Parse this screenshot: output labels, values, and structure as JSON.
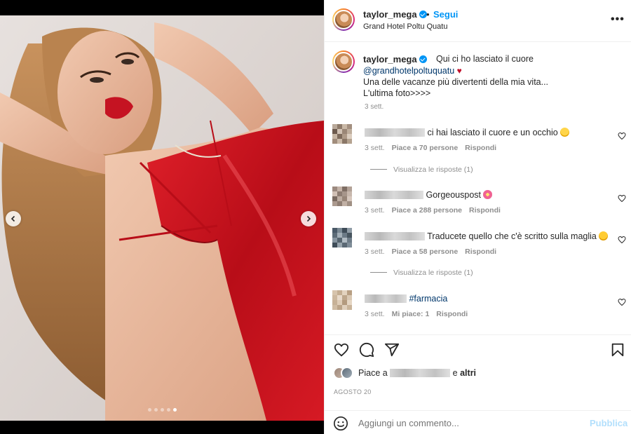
{
  "post": {
    "username": "taylor_mega",
    "bullet": "•",
    "follow_label": "Segui",
    "location": "Grand Hotel Poltu Quatu",
    "more_label": "•••"
  },
  "caption": {
    "username": "taylor_mega",
    "line1": "Qui ci ho lasciato il cuore",
    "mention": "@grandhotelpoltuquatu",
    "heart": "♥",
    "line2": "Una delle vacanze più divertenti della mia vita...",
    "line3": "L'ultima foto>>>>",
    "time": "3 sett."
  },
  "comments": [
    {
      "text": "ci hai lasciato il cuore e un occhio",
      "emoji": "grinning-emoji",
      "time": "3 sett.",
      "likes": "Piace a 70 persone",
      "reply": "Rispondi",
      "view_replies": "Visualizza le risposte (1)"
    },
    {
      "text": "Gorgeouspost",
      "emoji": "flower-emoji",
      "time": "3 sett.",
      "likes": "Piace a 288 persone",
      "reply": "Rispondi"
    },
    {
      "text": "Traducete quello che c'è scritto sulla maglia",
      "emoji": "heart-eyes-emoji",
      "time": "3 sett.",
      "likes": "Piace a 58 persone",
      "reply": "Rispondi",
      "view_replies": "Visualizza le risposte (1)"
    },
    {
      "text": "#farmacia",
      "time": "3 sett.",
      "likes": "Mi piace: 1",
      "reply": "Rispondi"
    }
  ],
  "actions": {
    "icons": [
      "heart-icon",
      "comment-icon",
      "share-icon",
      "bookmark-icon"
    ],
    "liked_prefix": "Piace a",
    "liked_and": "e",
    "liked_others": "altri",
    "date": "AGOSTO 20"
  },
  "add_comment": {
    "placeholder": "Aggiungi un commento...",
    "publish_label": "Pubblica"
  },
  "carousel": {
    "slides": 5,
    "active_index": 4
  },
  "colors": {
    "accent": "#0095f6",
    "mention": "#00376b",
    "muted": "#8e8e8e",
    "publish_disabled": "#b2dffc"
  }
}
